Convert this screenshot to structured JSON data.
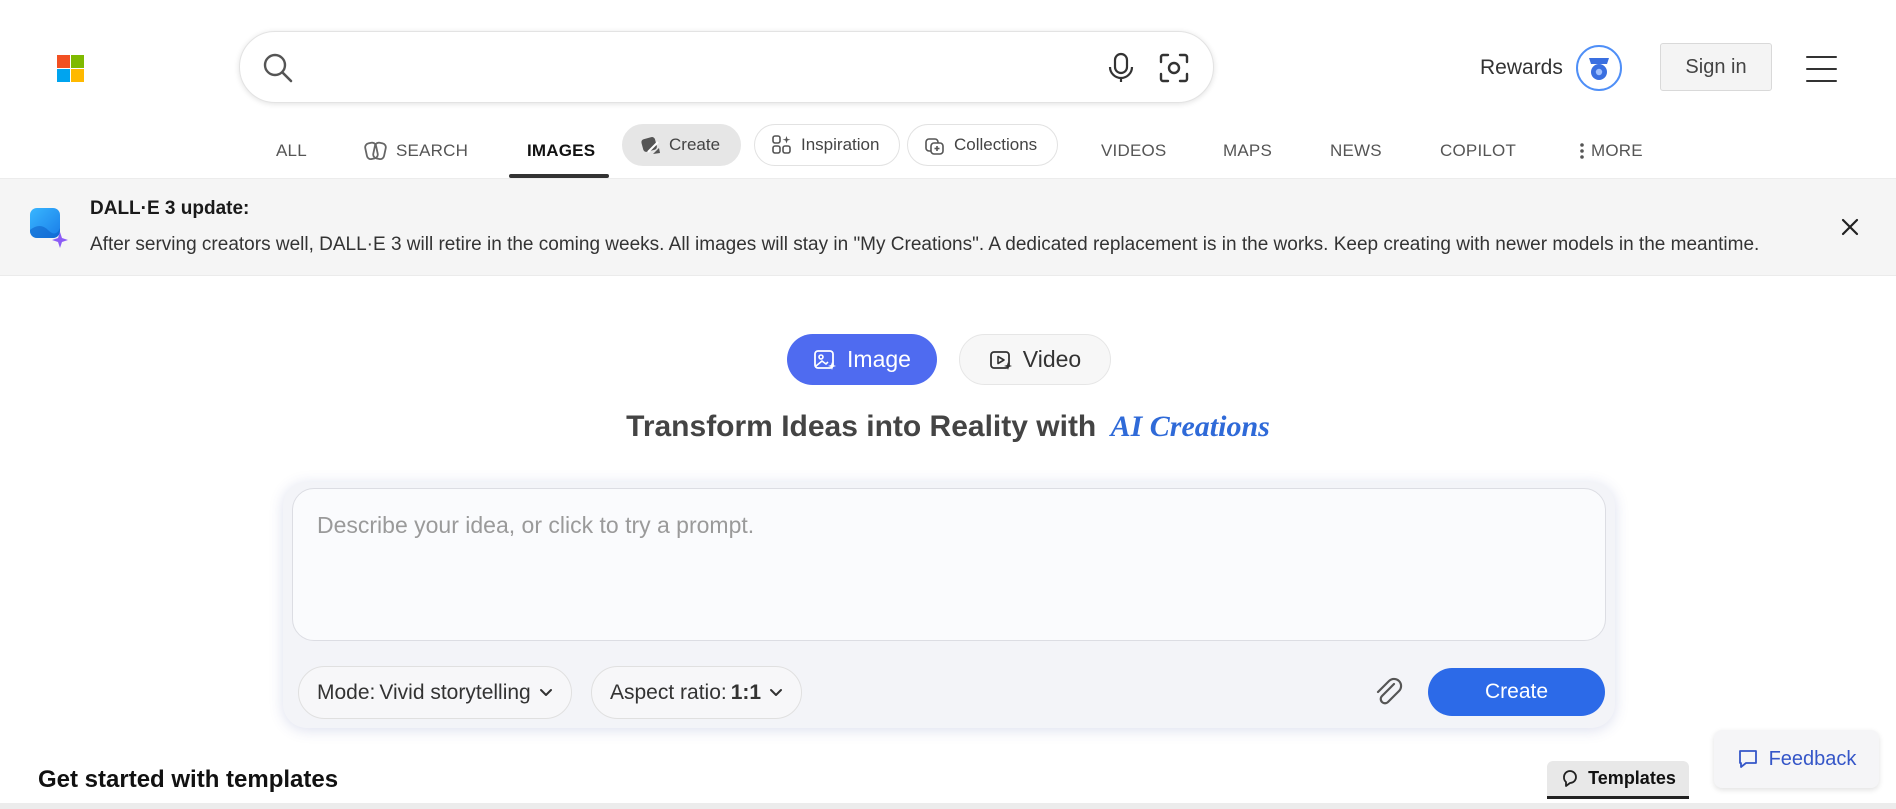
{
  "header": {
    "logo_colors": [
      "#f25022",
      "#7fba00",
      "#00a4ef",
      "#ffb900"
    ],
    "search": {
      "value": "",
      "placeholder": ""
    },
    "rewards_label": "Rewards",
    "signin_label": "Sign in"
  },
  "nav": {
    "items": [
      {
        "label": "ALL"
      },
      {
        "label": "SEARCH"
      },
      {
        "label": "IMAGES"
      },
      {
        "label": "Create"
      },
      {
        "label": "Inspiration"
      },
      {
        "label": "Collections"
      },
      {
        "label": "VIDEOS"
      },
      {
        "label": "MAPS"
      },
      {
        "label": "NEWS"
      },
      {
        "label": "COPILOT"
      },
      {
        "label": "MORE"
      }
    ],
    "active": "IMAGES"
  },
  "banner": {
    "title": "DALL·E 3 update:",
    "text": "After serving creators well, DALL·E 3 will retire in the coming weeks. All images will stay in \"My Creations\". A dedicated replacement is in the works. Keep creating with newer models in the meantime."
  },
  "toggle": {
    "image_label": "Image",
    "video_label": "Video",
    "selected": "Image"
  },
  "headline": {
    "main": "Transform Ideas into Reality with",
    "accent": "AI Creations"
  },
  "prompt": {
    "placeholder": "Describe your idea, or click to try a prompt.",
    "mode_label": "Mode:",
    "mode_value": "Vivid storytelling",
    "aspect_label": "Aspect ratio:",
    "aspect_value": "1:1",
    "create_label": "Create"
  },
  "templates": {
    "heading": "Get started with templates",
    "tab_label": "Templates"
  },
  "feedback_label": "Feedback",
  "colors": {
    "accent": "#4f6bf0",
    "create_button": "#2c6ae8",
    "headline_accent": "#2f6ad8"
  }
}
